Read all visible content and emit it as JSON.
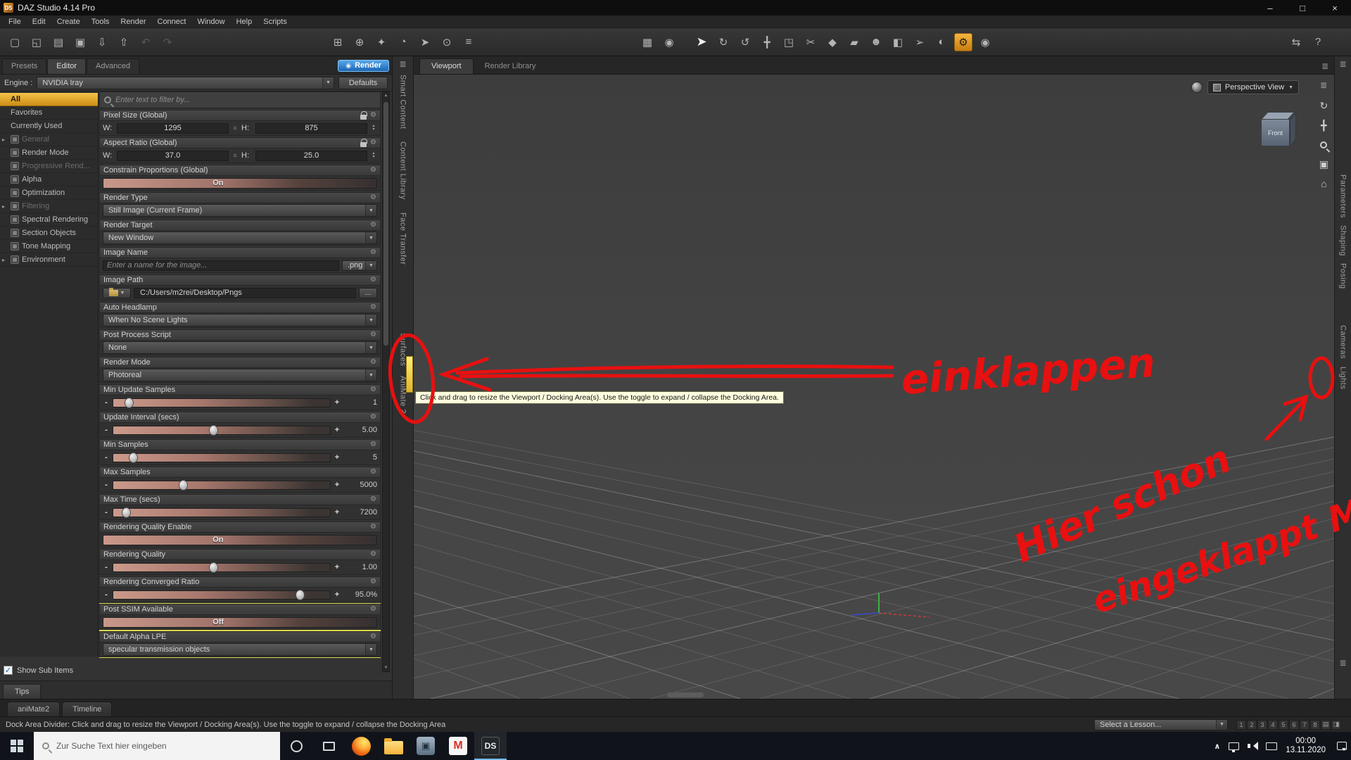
{
  "titlebar": {
    "app_icon": "DS",
    "title": "DAZ Studio 4.14 Pro",
    "buttons": {
      "minimize": "–",
      "maximize": "□",
      "close": "×"
    }
  },
  "menubar": [
    "File",
    "Edit",
    "Create",
    "Tools",
    "Render",
    "Connect",
    "Window",
    "Help",
    "Scripts"
  ],
  "toolbar": {
    "groups": [
      {
        "id": "file",
        "items": [
          {
            "name": "new-file-button",
            "glyph": "▢"
          },
          {
            "name": "open-file-button",
            "glyph": "◱"
          },
          {
            "name": "open-recent-button",
            "glyph": "▤"
          },
          {
            "name": "save-button",
            "glyph": "▣"
          },
          {
            "name": "import-button",
            "glyph": "⇩"
          },
          {
            "name": "export-button",
            "glyph": "⇧"
          },
          {
            "name": "undo-button",
            "glyph": "↶",
            "state": "disabled"
          },
          {
            "name": "redo-button",
            "glyph": "↷",
            "state": "disabled"
          }
        ]
      },
      {
        "id": "create",
        "items": [
          {
            "name": "create-group-button",
            "glyph": "⊞"
          },
          {
            "name": "create-node-button",
            "glyph": "⊕"
          },
          {
            "name": "create-light-button",
            "glyph": "✦"
          },
          {
            "name": "create-camera-button",
            "glyph": "◔"
          },
          {
            "name": "create-plane-button",
            "glyph": "➤"
          },
          {
            "name": "create-sphere-button",
            "glyph": "⊙"
          },
          {
            "name": "scene-list-button",
            "glyph": "≡"
          }
        ]
      },
      {
        "id": "mid",
        "items": [
          {
            "name": "grid-snap-button",
            "glyph": "▦"
          },
          {
            "name": "joint-editor-button",
            "glyph": "◉"
          }
        ]
      },
      {
        "id": "tools",
        "items": [
          {
            "name": "node-selection-tool",
            "glyph": "➤",
            "state": "big"
          },
          {
            "name": "rotate-tool",
            "glyph": "↻"
          },
          {
            "name": "orbit-tool",
            "glyph": "↺"
          },
          {
            "name": "translate-tool",
            "glyph": "╋"
          },
          {
            "name": "scale-tool",
            "glyph": "◳"
          },
          {
            "name": "geometry-editor-tool",
            "glyph": "✂"
          },
          {
            "name": "measure-tool",
            "glyph": "◆"
          },
          {
            "name": "weight-brush-tool",
            "glyph": "▰"
          },
          {
            "name": "figure-tool",
            "glyph": "☻"
          },
          {
            "name": "primitive-tool",
            "glyph": "◧"
          },
          {
            "name": "select-plus-tool",
            "glyph": "➢"
          },
          {
            "name": "shaded-view-tool",
            "glyph": "◐"
          },
          {
            "name": "render-settings-tool",
            "glyph": "⚙",
            "state": "active"
          },
          {
            "name": "spot-render-tool",
            "glyph": "◉"
          }
        ]
      },
      {
        "id": "right",
        "items": [
          {
            "name": "bridge-button",
            "glyph": "⇆"
          },
          {
            "name": "help-button",
            "glyph": "?"
          }
        ]
      }
    ]
  },
  "left_panel": {
    "tabs": [
      {
        "label": "Presets",
        "active": false
      },
      {
        "label": "Editor",
        "active": true
      },
      {
        "label": "Advanced",
        "active": false
      }
    ],
    "render_button": "Render",
    "engine": {
      "label": "Engine :",
      "value": "NVIDIA Iray",
      "defaults": "Defaults"
    },
    "filter_placeholder": "Enter text to filter by...",
    "categories": [
      {
        "label": "All",
        "state": "selected"
      },
      {
        "label": "Favorites"
      },
      {
        "label": "Currently Used"
      },
      {
        "label": "General",
        "state": "disabled",
        "arrow": true,
        "icon": true
      },
      {
        "label": "Render Mode",
        "icon": true
      },
      {
        "label": "Progressive Rend...",
        "state": "disabled",
        "icon": true
      },
      {
        "label": "Alpha",
        "icon": true
      },
      {
        "label": "Optimization",
        "icon": true
      },
      {
        "label": "Filtering",
        "state": "disabled",
        "arrow": true,
        "icon": true
      },
      {
        "label": "Spectral Rendering",
        "icon": true
      },
      {
        "label": "Section Objects",
        "icon": true
      },
      {
        "label": "Tone Mapping",
        "icon": true
      },
      {
        "label": "Environment",
        "arrow": true,
        "icon": true
      }
    ],
    "settings": [
      {
        "label": "Pixel Size (Global)",
        "type": "dual",
        "w_label": "W:",
        "h_label": "H:",
        "w": "1295",
        "h": "875",
        "lock": true
      },
      {
        "label": "Aspect Ratio (Global)",
        "type": "dual",
        "w_label": "W:",
        "h_label": "H:",
        "w": "37.0",
        "h": "25.0",
        "lock": true
      },
      {
        "label": "Constrain Proportions (Global)",
        "type": "toggle",
        "value": "On"
      },
      {
        "label": "Render Type",
        "type": "dropdown",
        "value": "Still Image (Current Frame)"
      },
      {
        "label": "Render Target",
        "type": "dropdown",
        "value": "New Window"
      },
      {
        "label": "Image Name",
        "type": "name-input",
        "placeholder": "Enter a name for the image...",
        "ext": ".png"
      },
      {
        "label": "Image Path",
        "type": "path",
        "value": "C:/Users/m2rei/Desktop/Pngs",
        "browse": "..."
      },
      {
        "label": "Auto Headlamp",
        "type": "dropdown",
        "value": "When No Scene Lights"
      },
      {
        "label": "Post Process Script",
        "type": "dropdown",
        "value": "None"
      },
      {
        "label": "Render Mode",
        "type": "dropdown",
        "value": "Photoreal"
      },
      {
        "label": "Min Update Samples",
        "type": "slider",
        "value": "1",
        "pos": 0.07
      },
      {
        "label": "Update Interval (secs)",
        "type": "slider",
        "value": "5.00",
        "pos": 0.46
      },
      {
        "label": "Min Samples",
        "type": "slider",
        "value": "5",
        "pos": 0.09
      },
      {
        "label": "Max Samples",
        "type": "slider",
        "value": "5000",
        "pos": 0.32
      },
      {
        "label": "Max Time (secs)",
        "type": "slider",
        "value": "7200",
        "pos": 0.06
      },
      {
        "label": "Rendering Quality Enable",
        "type": "toggle",
        "value": "On"
      },
      {
        "label": "Rendering Quality",
        "type": "slider",
        "value": "1.00",
        "pos": 0.46
      },
      {
        "label": "Rendering Converged Ratio",
        "type": "slider",
        "value": "95.0%",
        "pos": 0.86
      },
      {
        "label": "Post SSIM Available",
        "type": "toggle",
        "value": "Off",
        "highlight": true
      },
      {
        "label": "Default Alpha LPE",
        "type": "dropdown",
        "value": "specular transmission objects",
        "highlight": true
      }
    ],
    "show_sub_items": "Show Sub Items",
    "tips": "Tips"
  },
  "dock": {
    "left_tabs": [
      "Smart Content",
      "Content Library",
      "Face Transfer",
      "Surfaces",
      "AniMate 2"
    ],
    "right_tabs": [
      "Parameters",
      "Shaping",
      "Posing",
      "Cameras",
      "Lights"
    ]
  },
  "viewport": {
    "tabs": [
      "Viewport",
      "Render Library"
    ],
    "view_selector": "Perspective View",
    "nav_cube": "Front",
    "tooltip": "Click and drag to resize the Viewport / Docking Area(s). Use the toggle to expand / collapse the Docking Area."
  },
  "annotations": {
    "color": "#e81010",
    "einklappen": "einklappen",
    "line1": "Hier schon",
    "line2": "eingeklappt M"
  },
  "statusbar": {
    "text": "Dock Area Divider: Click and drag to resize the Viewport / Docking Area(s). Use the toggle to expand / collapse the Docking Area",
    "lesson": "Select a Lesson...",
    "pager": [
      "1",
      "2",
      "3",
      "4",
      "5",
      "6",
      "7",
      "8"
    ]
  },
  "bottom_tabs": [
    "aniMate2",
    "Timeline"
  ],
  "taskbar": {
    "search_placeholder": "Zur Suche Text hier eingeben",
    "gmail_label": "M",
    "daz_label": "DS",
    "clock": {
      "time": "00:00",
      "date": "13.11.2020"
    }
  },
  "colors": {
    "accent_orange": "#e9a640",
    "render_blue": "#2f7fd0",
    "slider_pink": "#c9988a",
    "highlight_yellow": "#ded84e",
    "annotation_red": "#e81010",
    "tooltip_bg": "#ffffdf"
  }
}
